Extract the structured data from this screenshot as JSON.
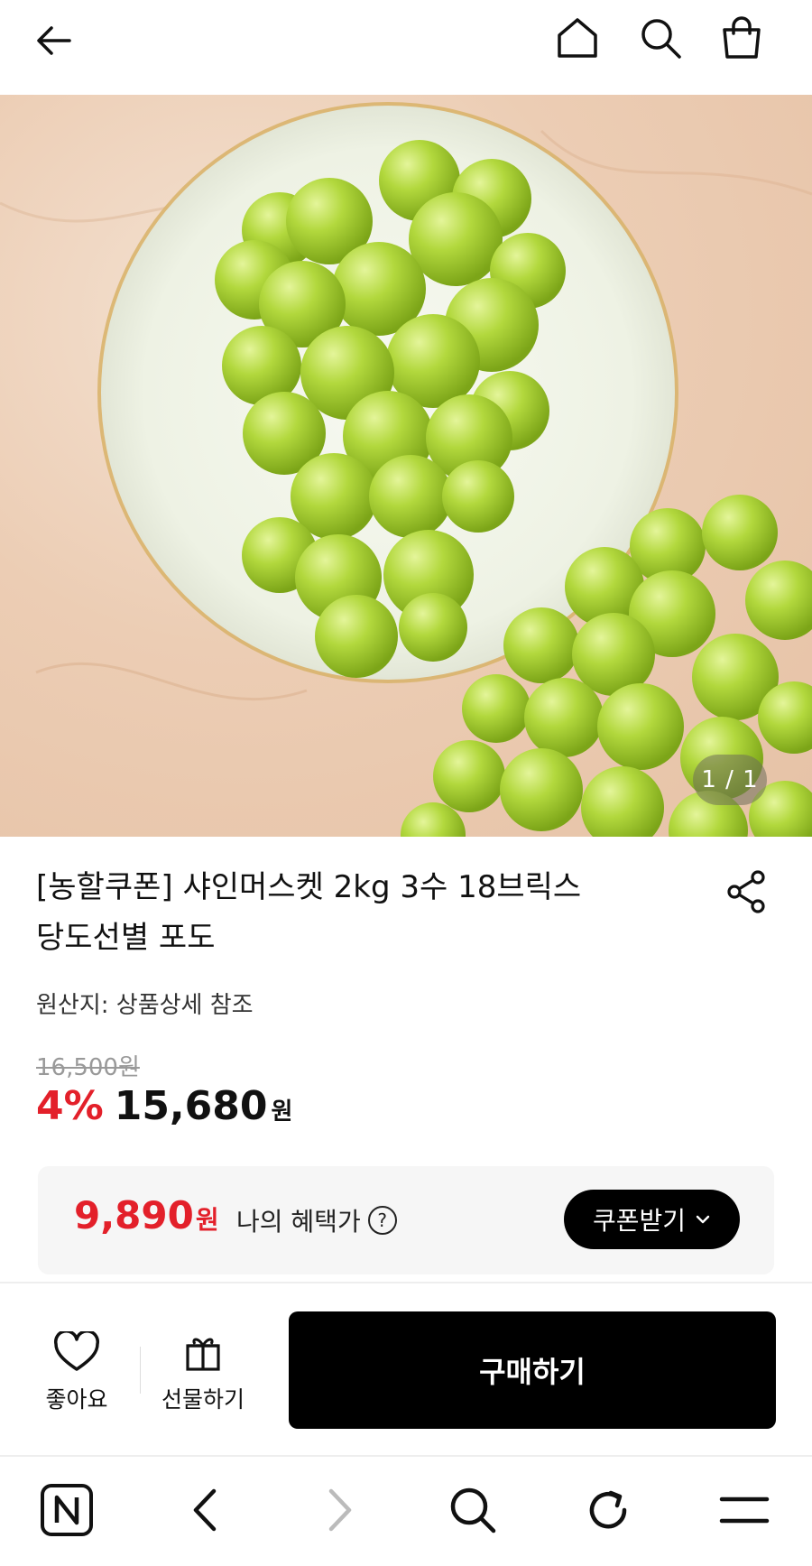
{
  "header": {
    "back_icon": "back-arrow-icon",
    "home_icon": "home-icon",
    "search_icon": "search-icon",
    "cart_icon": "shopping-bag-icon"
  },
  "gallery": {
    "counter": "1 / 1"
  },
  "product": {
    "title_line1": "[농할쿠폰] 샤인머스켓 2kg 3수 18브릭스",
    "title_line2": "당도선별 포도",
    "origin": "원산지: 상품상세 참조",
    "original_price": "16,500원",
    "discount": "4%",
    "price": "15,680",
    "currency": "원"
  },
  "benefit": {
    "price": "9,890",
    "currency": "원",
    "label": "나의 혜택가",
    "help_symbol": "?",
    "coupon_label": "쿠폰받기"
  },
  "actions": {
    "like_label": "좋아요",
    "gift_label": "선물하기",
    "buy_label": "구매하기"
  },
  "colors": {
    "accent_red": "#e3202a",
    "primary_black": "#000000",
    "grape_green": "#a8d13a"
  }
}
